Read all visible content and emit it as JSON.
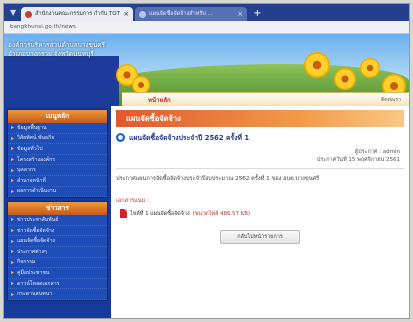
{
  "browser": {
    "tabs": [
      {
        "title": "สำนักงานคณะกรรมการ กำกับ TOT",
        "active": true
      },
      {
        "title": "แผนจัดซื้อจัดจ้างสำหรับ ...",
        "active": false
      }
    ],
    "new_tab": "+",
    "close": "×",
    "url": "bangkhunsi.go.th/news"
  },
  "site": {
    "title_line1": "องค์การบริหารส่วนตำบลบางขุนศรี",
    "title_line2": "อำเภอบางกรวย จังหวัดนนทบุรี",
    "menu_home": "หน้าหลัก",
    "menu_right": "ติดต่อเรา"
  },
  "sidebar": {
    "box1": {
      "header": "เมนูหลัก",
      "items": [
        "ข้อมูลพื้นฐาน",
        "วิสัยทัศน์ พันธกิจ",
        "ข้อมูลทั่วไป",
        "โครงสร้างองค์กร",
        "บุคลากร",
        "อำนาจหน้าที่",
        "ผลการดำเนินงาน"
      ]
    },
    "box2": {
      "header": "ข่าวสาร",
      "items": [
        "ข่าวประชาสัมพันธ์",
        "ข่าวจัดซื้อจัดจ้าง",
        "แผนจัดซื้อจัดจ้าง",
        "ประกาศต่างๆ",
        "กิจกรรม",
        "คู่มือประชาชน",
        "ดาวน์โหลดเอกสาร",
        "กระดานสนทนา"
      ]
    }
  },
  "content": {
    "section_header": "แผนจัดซื้อจัดจ้าง",
    "article_title": "แผนจัดซื้อจัดจ้างประจำปี 2562 ครั้งที่ 1",
    "meta_author": "ผู้ประกาศ : admin",
    "meta_date": "ประกาศวันที่ 15 พฤศจิกายน 2561",
    "description": "ประกาศแผนการจัดซื้อจัดจ้างประจำปีงบประมาณ 2562 ครั้งที่ 1 ของ อบต.บางขุนศรี",
    "attach_label": "เอกสารแนบ :",
    "attach_name": "ไฟล์ที่ 1 แผนจัดซื้อจัดจ้าง",
    "attach_size": "(ขนาดไฟล์ 486.57 KB)",
    "back_button": "กลับไปหน้ารายการ"
  }
}
